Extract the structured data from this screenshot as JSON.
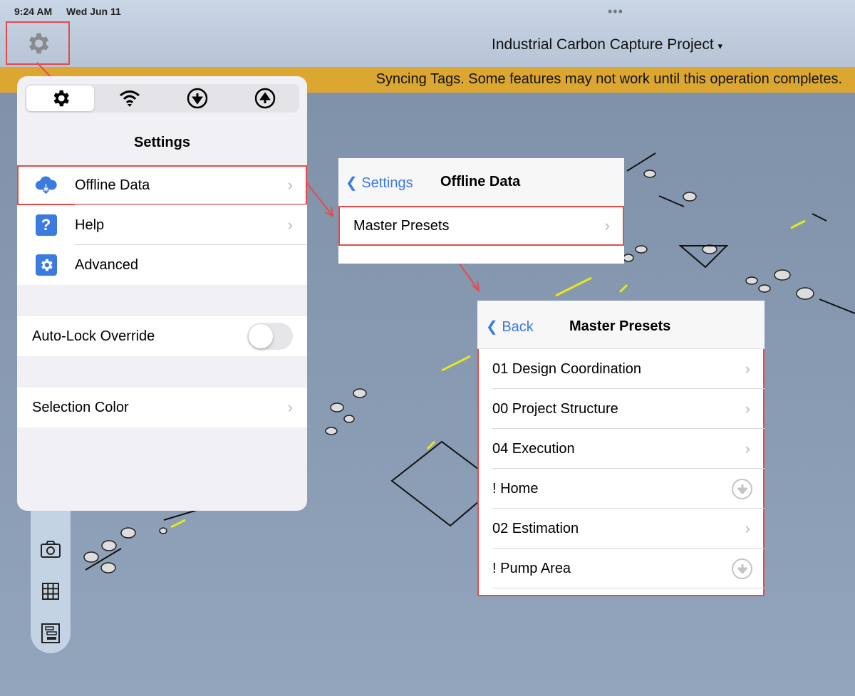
{
  "status": {
    "time": "9:24 AM",
    "date": "Wed Jun 11"
  },
  "header": {
    "project_title": "Industrial Carbon Capture Project",
    "dropdown_glyph": "▾"
  },
  "banner": {
    "text": "Syncing Tags. Some features may not work until this operation completes."
  },
  "settings_popover": {
    "segments": [
      {
        "icon": "gear-icon"
      },
      {
        "icon": "wifi-icon"
      },
      {
        "icon": "download-circle-icon"
      },
      {
        "icon": "upload-circle-icon"
      }
    ],
    "title": "Settings",
    "items": [
      {
        "label": "Offline Data",
        "icon": "cloud-download-icon"
      },
      {
        "label": "Help",
        "icon": "question-icon"
      },
      {
        "label": "Advanced",
        "icon": "gear-icon"
      }
    ],
    "auto_lock": {
      "label": "Auto-Lock Override",
      "on": false
    },
    "selection_color": {
      "label": "Selection Color"
    }
  },
  "offline_panel": {
    "back": "Settings",
    "title": "Offline Data",
    "items": [
      {
        "label": "Master Presets"
      }
    ]
  },
  "presets_panel": {
    "back": "Back",
    "title": "Master Presets",
    "items": [
      {
        "label": "01 Design Coordination",
        "action": "chevron"
      },
      {
        "label": "00 Project Structure",
        "action": "chevron"
      },
      {
        "label": "04 Execution",
        "action": "chevron"
      },
      {
        "label": "! Home",
        "action": "download"
      },
      {
        "label": "02 Estimation",
        "action": "chevron"
      },
      {
        "label": "! Pump Area",
        "action": "download"
      }
    ]
  },
  "colors": {
    "accent": "#3b7be0",
    "highlight": "#e84a4a",
    "banner": "#dca731"
  }
}
